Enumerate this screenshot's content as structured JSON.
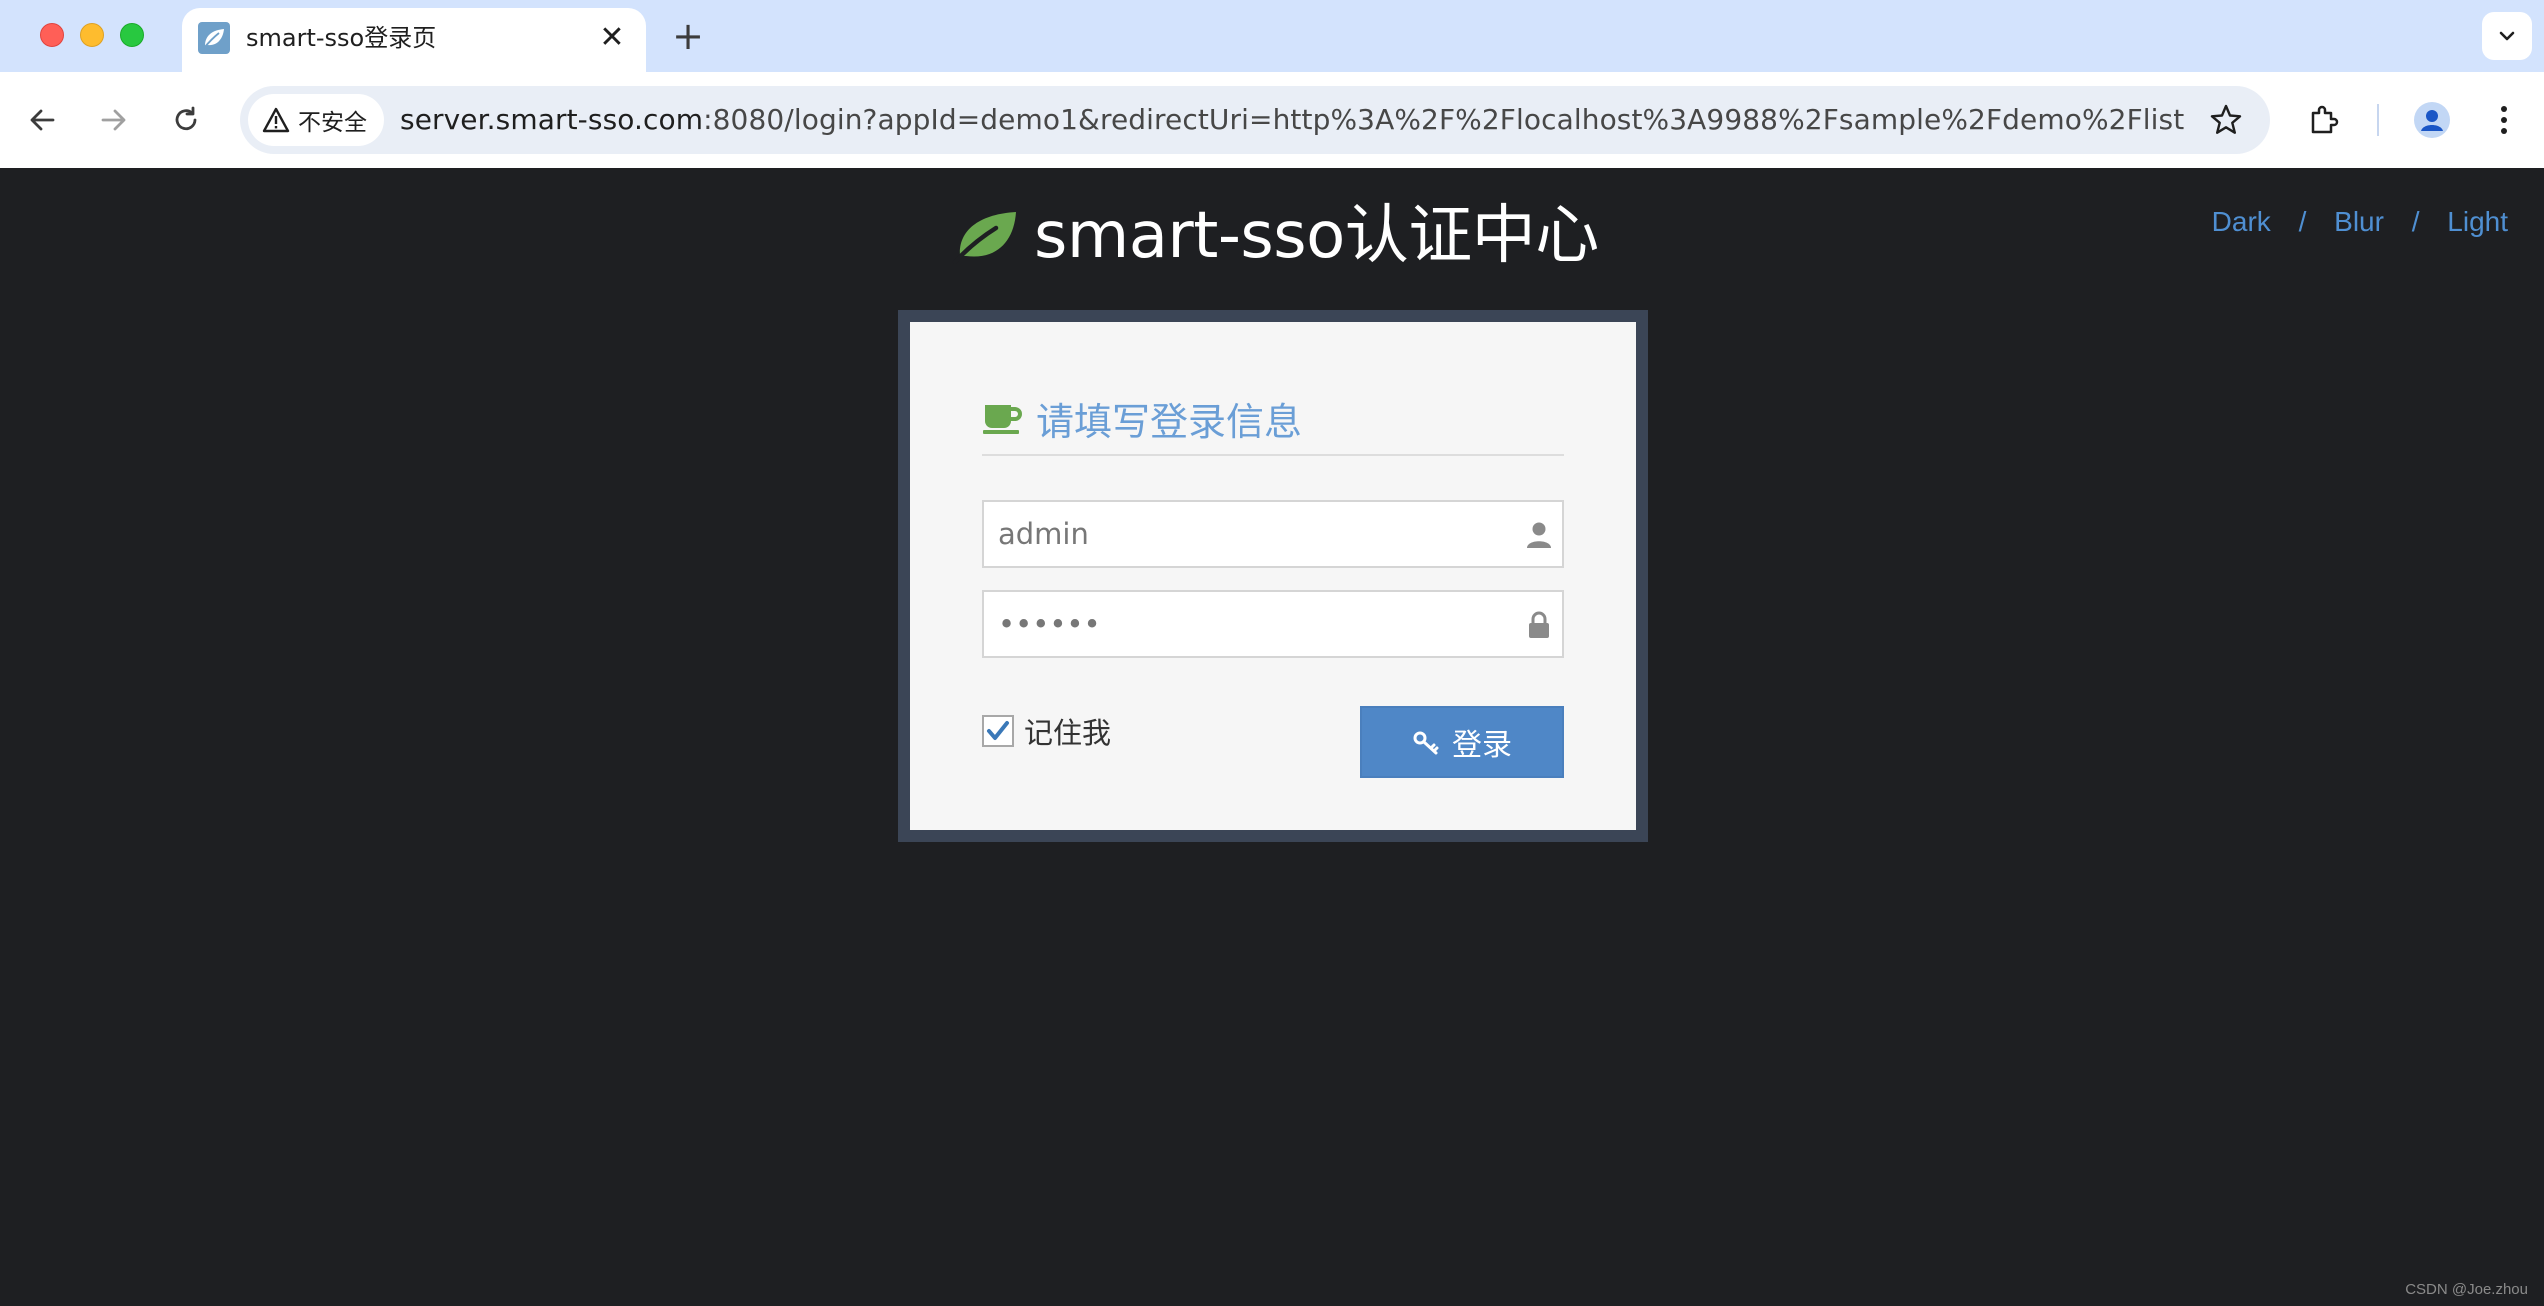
{
  "browser": {
    "tab": {
      "title": "smart-sso登录页",
      "favicon": "leaf-favicon"
    },
    "new_tab_glyph": "+",
    "close_glyph": "✕",
    "security_label": "不安全",
    "url_host": "server.smart-sso.com",
    "url_rest": ":8080/login?appId=demo1&redirectUri=http%3A%2F%2Flocalhost%3A9988%2Fsample%2Fdemo%2Flist"
  },
  "page": {
    "brand_title": "smart-sso认证中心",
    "theme_options": [
      "Dark",
      "Blur",
      "Light"
    ],
    "theme_separator": "/",
    "form": {
      "heading": "请填写登录信息",
      "username_value": "admin",
      "password_value": "••••••",
      "remember_label": "记住我",
      "remember_checked": true,
      "login_label": "登录"
    },
    "watermark": "CSDN @Joe.zhou"
  },
  "colors": {
    "page_bg": "#1e1f22",
    "brand_leaf": "#6aa84f",
    "heading_text": "#6a9ed6",
    "theme_link": "#4f8fd2",
    "login_button": "#4f87c7",
    "frame": "#3b4556"
  }
}
